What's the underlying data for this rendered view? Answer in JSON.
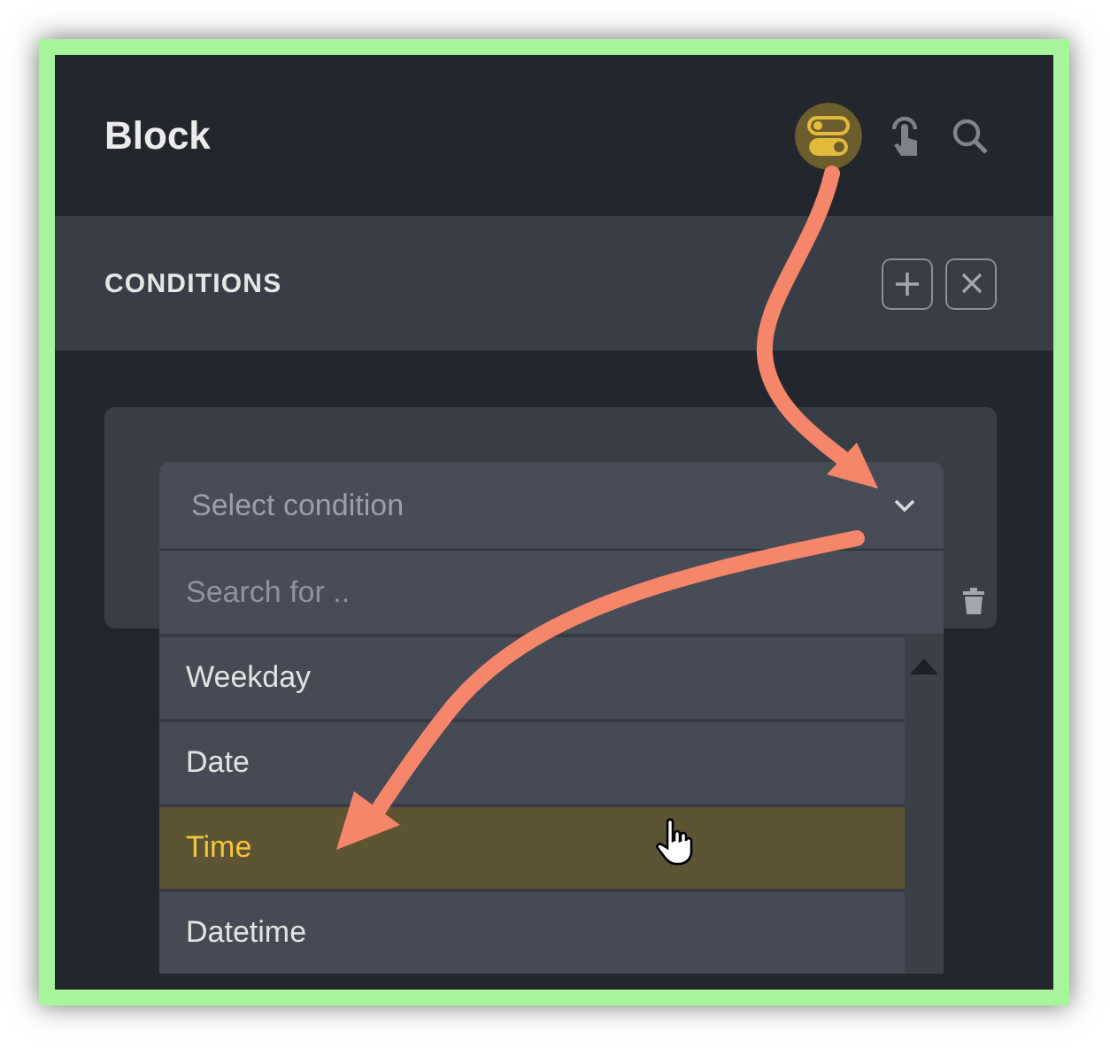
{
  "header": {
    "title": "Block"
  },
  "conditions": {
    "title": "CONDITIONS"
  },
  "condition_select": {
    "placeholder": "Select condition",
    "search": {
      "placeholder": "Search for .."
    },
    "options": [
      {
        "label": "Weekday",
        "selected": false
      },
      {
        "label": "Date",
        "selected": false
      },
      {
        "label": "Time",
        "selected": true
      },
      {
        "label": "Datetime",
        "selected": false
      }
    ]
  }
}
